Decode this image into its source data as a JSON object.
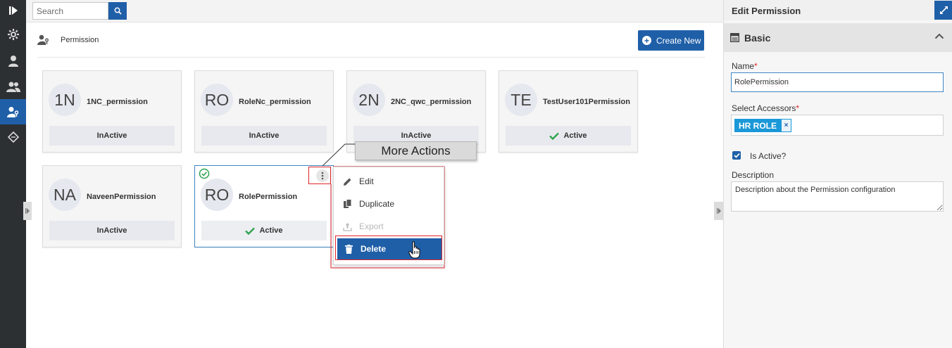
{
  "rail": {
    "items": [
      {
        "icon": "play-logo-icon"
      },
      {
        "icon": "gear-icon"
      },
      {
        "icon": "user-icon"
      },
      {
        "icon": "users-icon"
      },
      {
        "icon": "user-key-icon"
      },
      {
        "icon": "tag-icon"
      }
    ]
  },
  "search": {
    "placeholder": "Search"
  },
  "page": {
    "title": "Permission",
    "create_label": "Create New"
  },
  "cards": [
    {
      "initials": "1N",
      "name": "1NC_permission",
      "status": "InActive",
      "active": false
    },
    {
      "initials": "RO",
      "name": "RoleNc_permission",
      "status": "InActive",
      "active": false
    },
    {
      "initials": "2N",
      "name": "2NC_qwc_permission",
      "status": "InActive",
      "active": false
    },
    {
      "initials": "TE",
      "name": "TestUser101Permission",
      "status": "Active",
      "active": true
    },
    {
      "initials": "NA",
      "name": "NaveenPermission",
      "status": "InActive",
      "active": false
    },
    {
      "initials": "RO",
      "name": "RolePermission",
      "status": "Active",
      "active": true
    }
  ],
  "callout": {
    "text": "More Actions"
  },
  "menu": {
    "items": [
      {
        "label": "Edit"
      },
      {
        "label": "Duplicate"
      },
      {
        "label": "Export"
      },
      {
        "label": "Delete"
      }
    ]
  },
  "panel": {
    "title": "Edit Permission",
    "section": "Basic",
    "name_label": "Name",
    "name_value": "RolePermission",
    "accessors_label": "Select Accessors",
    "accessor_chip": "HR ROLE",
    "chip_remove": "×",
    "required_mark": "*",
    "is_active_label": "Is Active?",
    "description_label": "Description",
    "description_value": "Description about the Permission configuration"
  },
  "colors": {
    "primary": "#1f5fa8",
    "rail": "#2d3033",
    "success": "#2ea44f",
    "callout_border": "#e0242b"
  }
}
